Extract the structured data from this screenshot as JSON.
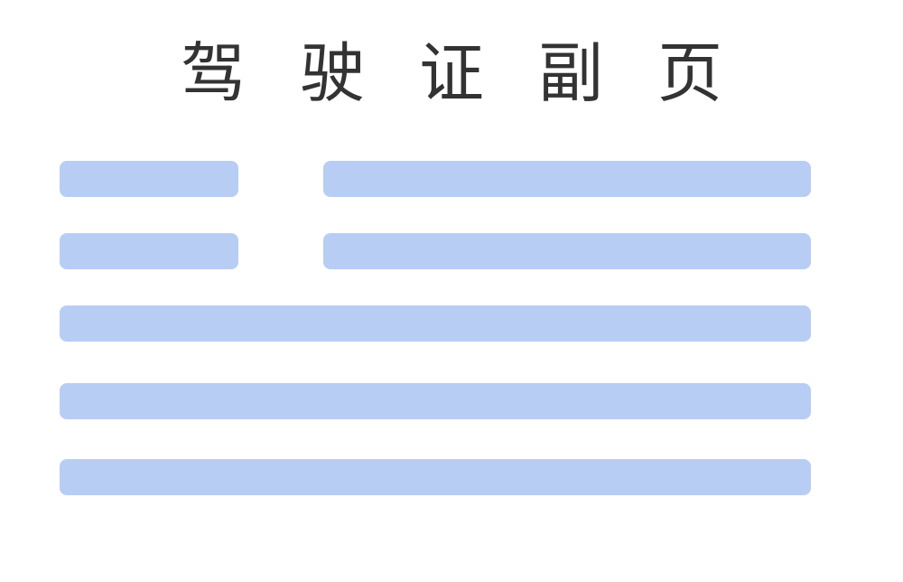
{
  "document": {
    "title": "驾驶证副页"
  },
  "colors": {
    "placeholder_bar": "#b8cdf4",
    "title_text": "#333333",
    "background": "#ffffff"
  }
}
